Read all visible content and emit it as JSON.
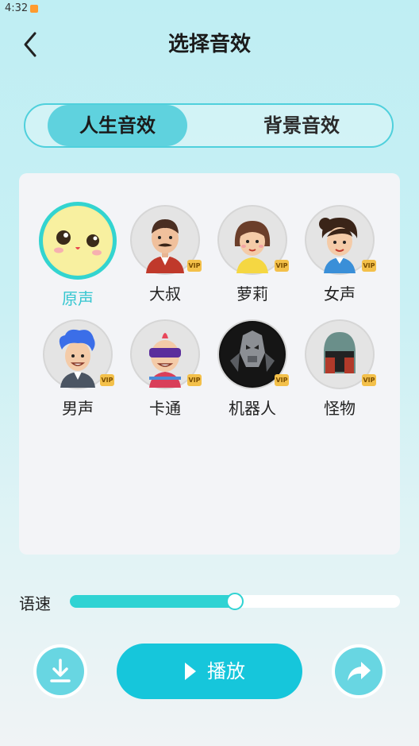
{
  "status": {
    "time": "4:32"
  },
  "header": {
    "title": "选择音效"
  },
  "tabs": [
    {
      "label": "人生音效",
      "active": true
    },
    {
      "label": "背景音效",
      "active": false
    }
  ],
  "effects": [
    {
      "label": "原声",
      "icon": "cute-face-icon",
      "selected": true,
      "vip": false
    },
    {
      "label": "大叔",
      "icon": "uncle-avatar-icon",
      "selected": false,
      "vip": true
    },
    {
      "label": "萝莉",
      "icon": "girl-avatar-icon",
      "selected": false,
      "vip": true
    },
    {
      "label": "女声",
      "icon": "woman-avatar-icon",
      "selected": false,
      "vip": true
    },
    {
      "label": "男声",
      "icon": "man-avatar-icon",
      "selected": false,
      "vip": true
    },
    {
      "label": "卡通",
      "icon": "cartoon-avatar-icon",
      "selected": false,
      "vip": true
    },
    {
      "label": "机器人",
      "icon": "robot-avatar-icon",
      "selected": false,
      "vip": true
    },
    {
      "label": "怪物",
      "icon": "monster-helmet-icon",
      "selected": false,
      "vip": true
    }
  ],
  "vip_text": "VIP",
  "speed": {
    "label": "语速",
    "value": 0.5
  },
  "actions": {
    "play_label": "播放",
    "download_icon": "download-icon",
    "share_icon": "share-icon"
  },
  "colors": {
    "accent": "#2fd3d3",
    "play_button": "#16c6db",
    "tab_active": "#5fd2de",
    "selected_label": "#35c6d0"
  }
}
